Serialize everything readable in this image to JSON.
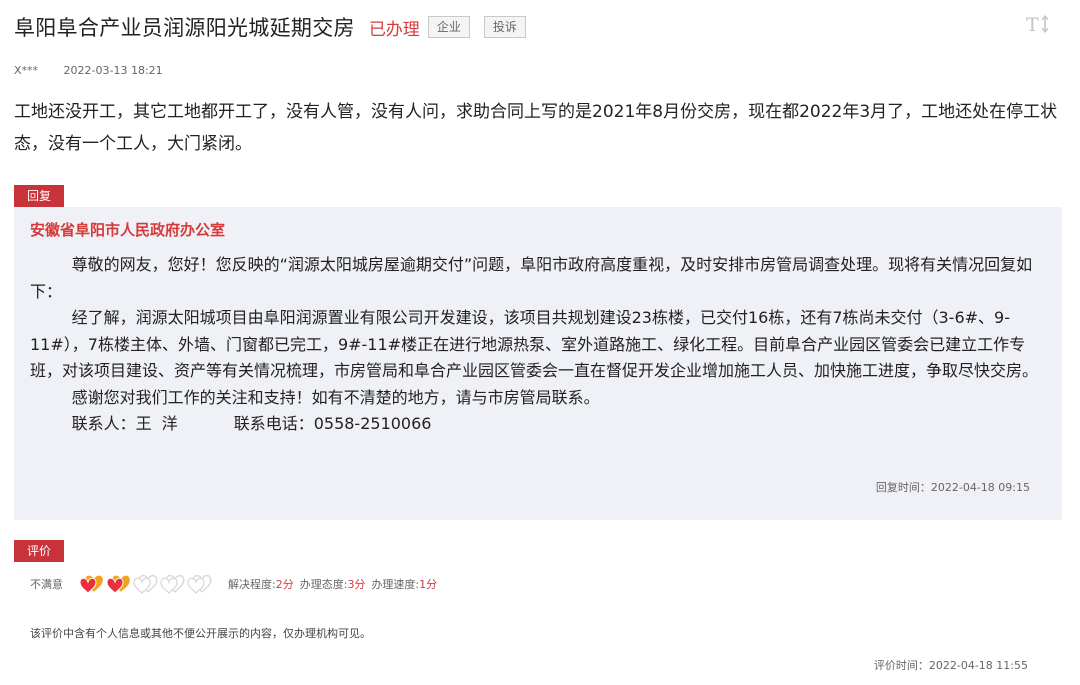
{
  "header": {
    "title": "阜阳阜合产业员润源阳光城延期交房",
    "status": "已办理",
    "tags": [
      "企业",
      "投诉"
    ],
    "font_toggle_icon": "font-size-icon"
  },
  "meta": {
    "author": "X***",
    "date": "2022-03-13 18:21"
  },
  "question": {
    "text": "工地还没开工，其它工地都开工了，没有人管，没有人问，求助合同上写的是2021年8月份交房，现在都2022年3月了，工地还处在停工状态，没有一个工人，大门紧闭。"
  },
  "reply": {
    "label": "回复",
    "org": "安徽省阜阳市人民政府办公室",
    "paragraphs": [
      "尊敬的网友，您好！您反映的“润源太阳城房屋逾期交付”问题，阜阳市政府高度重视，及时安排市房管局调查处理。现将有关情况回复如下：",
      "经了解，润源太阳城项目由阜阳润源置业有限公司开发建设，该项目共规划建设23栋楼，已交付16栋，还有7栋尚未交付（3-6#、9-11#），7栋楼主体、外墙、门窗都已完工，9#-11#楼正在进行地源热泵、室外道路施工、绿化工程。目前阜合产业园区管委会已建立工作专班，对该项目建设、资产等有关情况梳理，市房管局和阜合产业园区管委会一直在督促开发企业增加施工人员、加快施工进度，争取尽快交房。",
      "感谢您对我们工作的关注和支持！如有不清楚的地方，请与市房管局联系。"
    ],
    "contact": "联系人：王  洋           联系电话：0558-2510066",
    "time": "回复时间：2022-04-18 09:15"
  },
  "evaluation": {
    "label": "评价",
    "overall": "不满意",
    "hearts_filled": 2,
    "hearts_total": 5,
    "colors": {
      "heart_filled_front": "#e8313d",
      "heart_filled_back": "#f3a21b",
      "heart_empty": "#d9d9d9",
      "accent": "#c8333a"
    },
    "scores": [
      {
        "label": "解决程度:",
        "value": "2分"
      },
      {
        "label": "办理态度:",
        "value": "3分"
      },
      {
        "label": "办理速度:",
        "value": "1分"
      }
    ],
    "notice": "该评价中含有个人信息或其他不便公开展示的内容，仅办理机构可见。",
    "time": "评价时间：2022-04-18 11:55"
  }
}
